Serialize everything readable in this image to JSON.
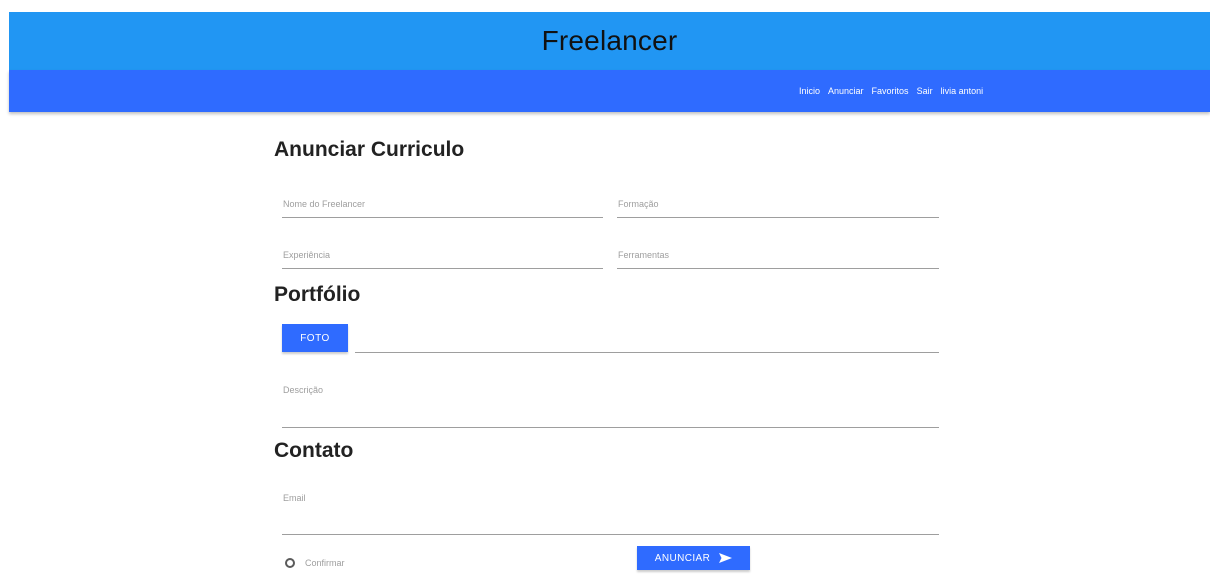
{
  "header": {
    "brand": "Freelancer"
  },
  "nav": {
    "items": [
      {
        "label": "Inicio"
      },
      {
        "label": "Anunciar"
      },
      {
        "label": "Favoritos"
      },
      {
        "label": "Sair"
      },
      {
        "label": "livia antoni"
      }
    ]
  },
  "form": {
    "title": "Anunciar Curriculo",
    "fields": {
      "nome": {
        "label": "Nome do Freelancer",
        "value": ""
      },
      "formacao": {
        "label": "Formação",
        "value": ""
      },
      "experiencia": {
        "label": "Experiência",
        "value": ""
      },
      "ferramentas": {
        "label": "Ferramentas",
        "value": ""
      }
    },
    "portfolio": {
      "title": "Portfólio",
      "foto_button": "FOTO",
      "descricao": {
        "label": "Descrição",
        "value": ""
      }
    },
    "contato": {
      "title": "Contato",
      "email": {
        "label": "Email",
        "value": ""
      }
    },
    "confirm_label": "Confirmar",
    "submit_label": "ANUNCIAR",
    "submit_icon": "send-icon"
  },
  "colors": {
    "brand_bar": "#2196f3",
    "nav_bar": "#2f6bff",
    "button": "#2f6bff"
  }
}
